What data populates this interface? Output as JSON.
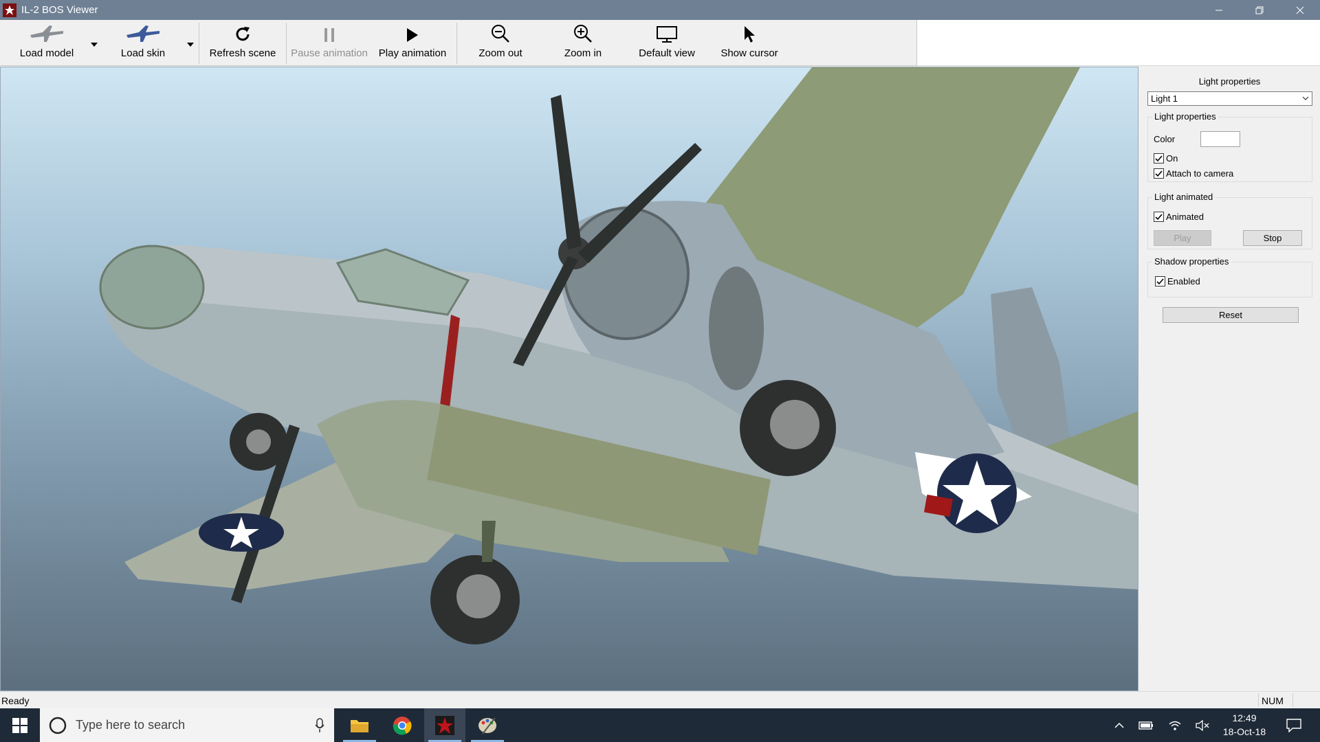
{
  "window": {
    "title": "IL-2 BOS Viewer"
  },
  "toolbar": {
    "load_model": "Load model",
    "load_skin": "Load skin",
    "refresh_scene": "Refresh scene",
    "pause_animation": "Pause animation",
    "play_animation": "Play animation",
    "zoom_out": "Zoom out",
    "zoom_in": "Zoom in",
    "default_view": "Default view",
    "show_cursor": "Show cursor"
  },
  "panel": {
    "title": "Light properties",
    "light_select": "Light 1",
    "light_group": {
      "title": "Light properties",
      "color_label": "Color",
      "color_value": "#ffffff",
      "on_label": "On",
      "on_checked": true,
      "attach_label": "Attach to camera",
      "attach_checked": true
    },
    "animated_group": {
      "title": "Light animated",
      "animated_label": "Animated",
      "animated_checked": true,
      "play_label": "Play",
      "stop_label": "Stop"
    },
    "shadow_group": {
      "title": "Shadow properties",
      "enabled_label": "Enabled",
      "enabled_checked": true
    },
    "reset_label": "Reset"
  },
  "statusbar": {
    "status": "Ready",
    "num": "NUM"
  },
  "taskbar": {
    "search_placeholder": "Type here to search",
    "time": "12:49",
    "date": "18-Oct-18"
  },
  "colors": {
    "titlebar": "#6f8094",
    "taskbar": "#1f2a38",
    "viewport_sky_top": "#cfe6f3",
    "viewport_sky_bottom": "#5c6f7f"
  }
}
